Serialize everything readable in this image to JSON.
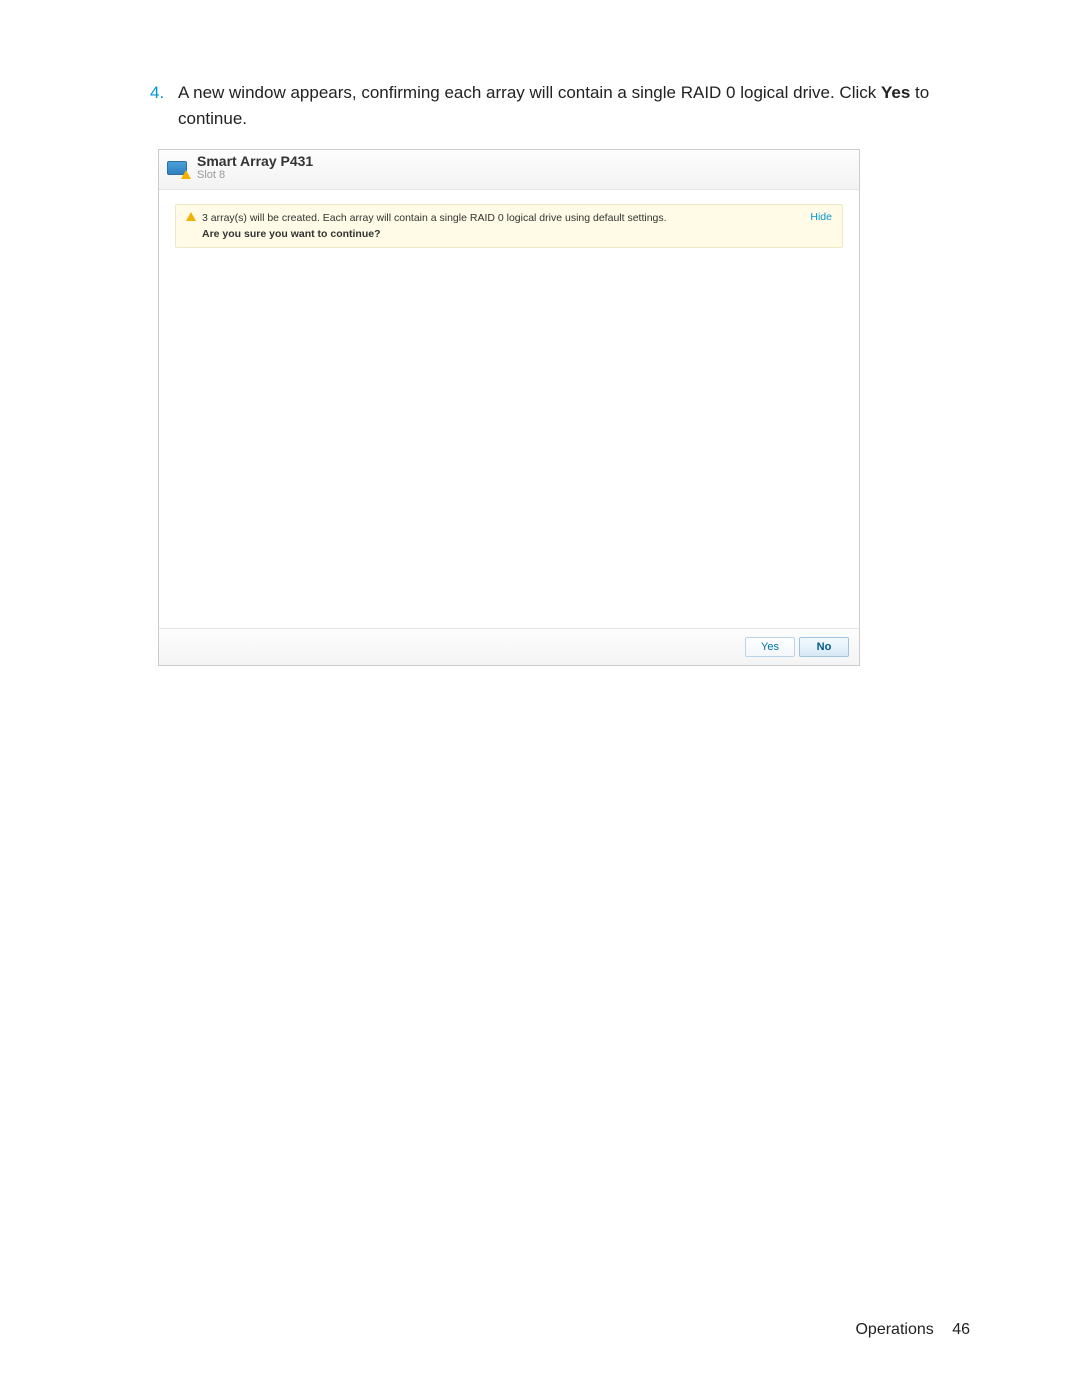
{
  "step": {
    "number": "4.",
    "text_before_bold": "A new window appears, confirming each array will contain a single RAID 0 logical drive. Click ",
    "bold": "Yes",
    "text_after_bold": " to continue."
  },
  "dialog": {
    "title": "Smart Array P431",
    "subtitle": "Slot 8",
    "alert": {
      "message": "3 array(s) will be created. Each array will contain a single RAID 0 logical drive using default settings.",
      "confirm": "Are you sure you want to continue?",
      "hide_label": "Hide"
    },
    "buttons": {
      "yes": "Yes",
      "no": "No"
    }
  },
  "footer": {
    "section": "Operations",
    "page": "46"
  }
}
